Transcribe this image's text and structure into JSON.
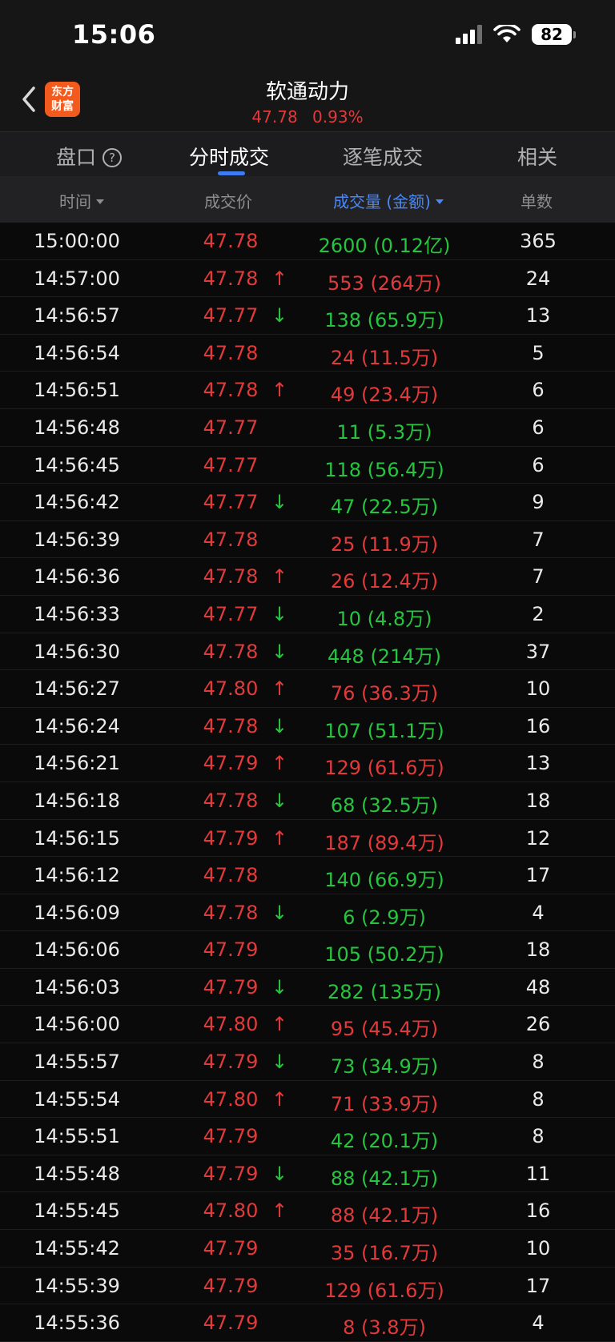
{
  "status_bar": {
    "time": "15:06",
    "battery": "82"
  },
  "header": {
    "logo_line1": "东方",
    "logo_line2": "财富",
    "stock_name": "软通动力",
    "price": "47.78",
    "change_pct": "0.93%"
  },
  "tabs": [
    {
      "label": "盘口",
      "active": false
    },
    {
      "label": "分时成交",
      "active": true
    },
    {
      "label": "逐笔成交",
      "active": false
    },
    {
      "label": "相关",
      "active": false
    }
  ],
  "columns": {
    "time": "时间",
    "price": "成交价",
    "volume": "成交量 (金额)",
    "count": "单数"
  },
  "colors": {
    "up": "#e23a3a",
    "down": "#27c43f",
    "accent": "#3d7cf0"
  },
  "rows": [
    {
      "time": "15:00:00",
      "price": "47.78",
      "arrow": "",
      "vol": "2600 (0.12亿)",
      "dir": "down",
      "count": "365"
    },
    {
      "time": "14:57:00",
      "price": "47.78",
      "arrow": "↑",
      "vol": "553 (264万)",
      "dir": "up",
      "count": "24"
    },
    {
      "time": "14:56:57",
      "price": "47.77",
      "arrow": "↓",
      "vol": "138 (65.9万)",
      "dir": "down",
      "count": "13"
    },
    {
      "time": "14:56:54",
      "price": "47.78",
      "arrow": "",
      "vol": "24 (11.5万)",
      "dir": "up",
      "count": "5"
    },
    {
      "time": "14:56:51",
      "price": "47.78",
      "arrow": "↑",
      "vol": "49 (23.4万)",
      "dir": "up",
      "count": "6"
    },
    {
      "time": "14:56:48",
      "price": "47.77",
      "arrow": "",
      "vol": "11 (5.3万)",
      "dir": "down",
      "count": "6"
    },
    {
      "time": "14:56:45",
      "price": "47.77",
      "arrow": "",
      "vol": "118 (56.4万)",
      "dir": "down",
      "count": "6"
    },
    {
      "time": "14:56:42",
      "price": "47.77",
      "arrow": "↓",
      "vol": "47 (22.5万)",
      "dir": "down",
      "count": "9"
    },
    {
      "time": "14:56:39",
      "price": "47.78",
      "arrow": "",
      "vol": "25 (11.9万)",
      "dir": "up",
      "count": "7"
    },
    {
      "time": "14:56:36",
      "price": "47.78",
      "arrow": "↑",
      "vol": "26 (12.4万)",
      "dir": "up",
      "count": "7"
    },
    {
      "time": "14:56:33",
      "price": "47.77",
      "arrow": "↓",
      "vol": "10 (4.8万)",
      "dir": "down",
      "count": "2"
    },
    {
      "time": "14:56:30",
      "price": "47.78",
      "arrow": "↓",
      "vol": "448 (214万)",
      "dir": "down",
      "count": "37"
    },
    {
      "time": "14:56:27",
      "price": "47.80",
      "arrow": "↑",
      "vol": "76 (36.3万)",
      "dir": "up",
      "count": "10"
    },
    {
      "time": "14:56:24",
      "price": "47.78",
      "arrow": "↓",
      "vol": "107 (51.1万)",
      "dir": "down",
      "count": "16"
    },
    {
      "time": "14:56:21",
      "price": "47.79",
      "arrow": "↑",
      "vol": "129 (61.6万)",
      "dir": "up",
      "count": "13"
    },
    {
      "time": "14:56:18",
      "price": "47.78",
      "arrow": "↓",
      "vol": "68 (32.5万)",
      "dir": "down",
      "count": "18"
    },
    {
      "time": "14:56:15",
      "price": "47.79",
      "arrow": "↑",
      "vol": "187 (89.4万)",
      "dir": "up",
      "count": "12"
    },
    {
      "time": "14:56:12",
      "price": "47.78",
      "arrow": "",
      "vol": "140 (66.9万)",
      "dir": "down",
      "count": "17"
    },
    {
      "time": "14:56:09",
      "price": "47.78",
      "arrow": "↓",
      "vol": "6 (2.9万)",
      "dir": "down",
      "count": "4"
    },
    {
      "time": "14:56:06",
      "price": "47.79",
      "arrow": "",
      "vol": "105 (50.2万)",
      "dir": "down",
      "count": "18"
    },
    {
      "time": "14:56:03",
      "price": "47.79",
      "arrow": "↓",
      "vol": "282 (135万)",
      "dir": "down",
      "count": "48"
    },
    {
      "time": "14:56:00",
      "price": "47.80",
      "arrow": "↑",
      "vol": "95 (45.4万)",
      "dir": "up",
      "count": "26"
    },
    {
      "time": "14:55:57",
      "price": "47.79",
      "arrow": "↓",
      "vol": "73 (34.9万)",
      "dir": "down",
      "count": "8"
    },
    {
      "time": "14:55:54",
      "price": "47.80",
      "arrow": "↑",
      "vol": "71 (33.9万)",
      "dir": "up",
      "count": "8"
    },
    {
      "time": "14:55:51",
      "price": "47.79",
      "arrow": "",
      "vol": "42 (20.1万)",
      "dir": "down",
      "count": "8"
    },
    {
      "time": "14:55:48",
      "price": "47.79",
      "arrow": "↓",
      "vol": "88 (42.1万)",
      "dir": "down",
      "count": "11"
    },
    {
      "time": "14:55:45",
      "price": "47.80",
      "arrow": "↑",
      "vol": "88 (42.1万)",
      "dir": "up",
      "count": "16"
    },
    {
      "time": "14:55:42",
      "price": "47.79",
      "arrow": "",
      "vol": "35 (16.7万)",
      "dir": "up",
      "count": "10"
    },
    {
      "time": "14:55:39",
      "price": "47.79",
      "arrow": "",
      "vol": "129 (61.6万)",
      "dir": "up",
      "count": "17"
    },
    {
      "time": "14:55:36",
      "price": "47.79",
      "arrow": "",
      "vol": "8 (3.8万)",
      "dir": "up",
      "count": "4"
    }
  ]
}
